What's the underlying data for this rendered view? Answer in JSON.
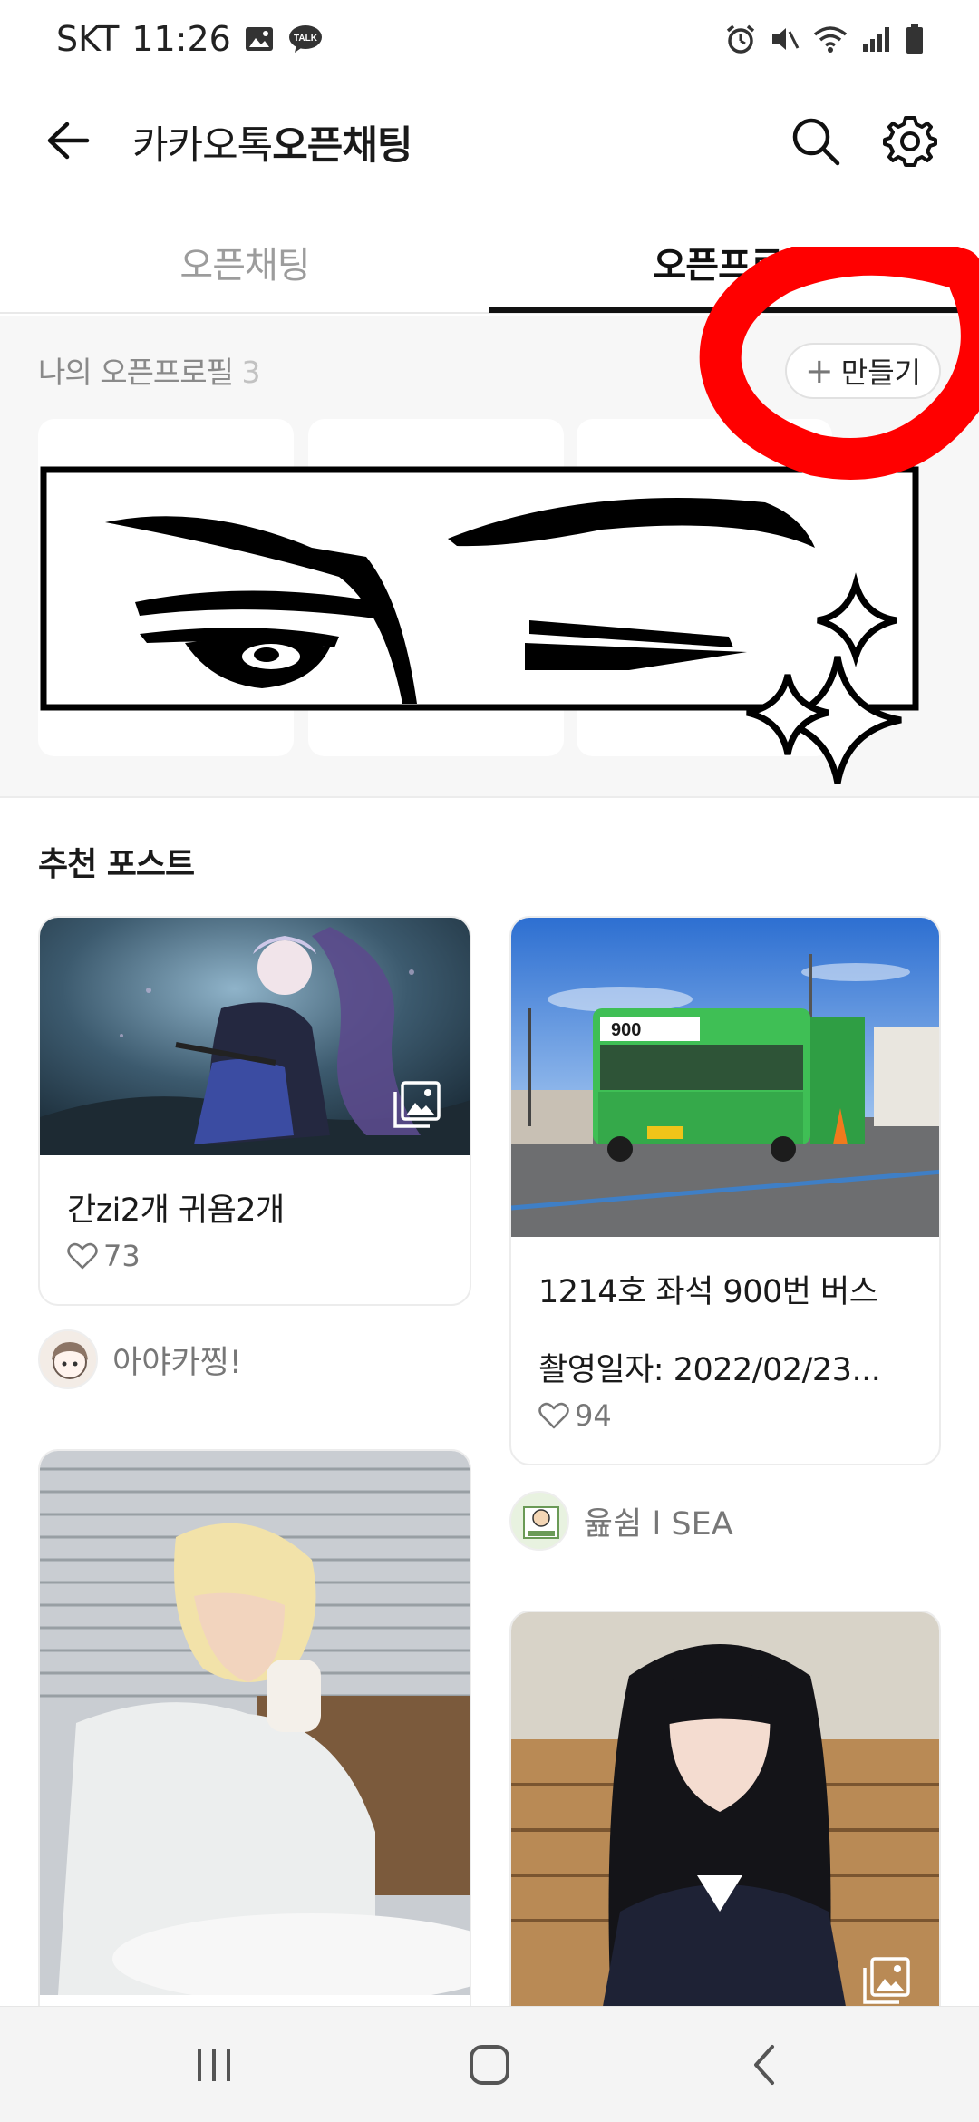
{
  "status_bar": {
    "carrier": "SKT",
    "time": "11:26",
    "talk_badge": "TALK"
  },
  "header": {
    "title_prefix": "카카오톡",
    "title_bold": "오픈채팅"
  },
  "tabs": [
    {
      "label": "오픈채팅",
      "active": false
    },
    {
      "label": "오픈프로필",
      "active": true
    }
  ],
  "my_profile": {
    "label": "나의 오픈프로필",
    "count": "3",
    "create_button_label": "만들기",
    "card_count": 3
  },
  "annotation": {
    "color": "#ff0000",
    "shape": "hand-drawn circle around create button"
  },
  "recommended": {
    "title": "추천 포스트",
    "posts": [
      {
        "text": "간zi2개 귀욤2개",
        "likes": "73",
        "author": "아야카찡!"
      },
      {
        "text_line1": "1214호 좌석 900번 버스",
        "text_line2": "촬영일자: 2022/02/23...",
        "likes": "94",
        "author": "윮쉼 l SEA"
      }
    ]
  },
  "icons": {
    "back": "arrow-left-icon",
    "search": "search-icon",
    "settings": "gear-icon",
    "heart": "heart-icon",
    "gallery": "gallery-icon",
    "plus": "plus-icon"
  },
  "colors": {
    "accent": "#111111",
    "muted": "#9c9c9c",
    "section_bg": "#f7f7f7",
    "annotation": "#ff0000"
  }
}
